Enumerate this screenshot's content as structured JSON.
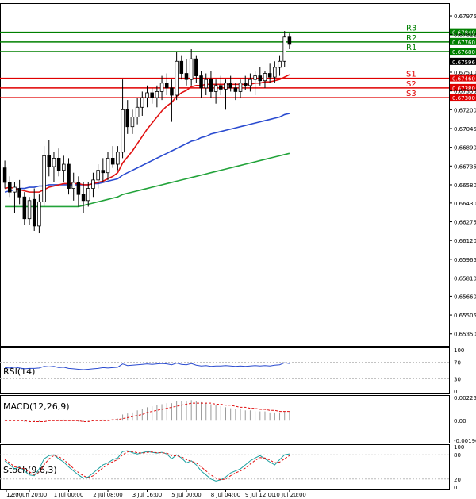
{
  "chart_data": {
    "type": "candlestick",
    "main": {
      "ylim": [
        0.6525,
        0.6808
      ],
      "price_ticks": [
        "0.67975",
        "0.67822",
        "0.67510",
        "0.67355",
        "0.67200",
        "0.67045",
        "0.66890",
        "0.66735",
        "0.66580",
        "0.66430",
        "0.66275",
        "0.66120",
        "0.65965",
        "0.65810",
        "0.65660",
        "0.65505",
        "0.65350"
      ],
      "current_price": 0.67596,
      "current_price_label": "0.67596",
      "levels": [
        {
          "name": "R3",
          "value": 0.6784,
          "label": "0.67840",
          "color": "#008000"
        },
        {
          "name": "R2",
          "value": 0.6776,
          "label": "0.67760",
          "color": "#008000"
        },
        {
          "name": "R1",
          "value": 0.6768,
          "label": "0.67680",
          "color": "#008000"
        },
        {
          "name": "S1",
          "value": 0.6746,
          "label": "0.67460",
          "color": "#e00000"
        },
        {
          "name": "S2",
          "value": 0.6738,
          "label": "0.67380",
          "color": "#e00000"
        },
        {
          "name": "S3",
          "value": 0.673,
          "label": "0.67300",
          "color": "#e00000"
        }
      ],
      "candles": [
        {
          "o": 0.6672,
          "h": 0.6678,
          "l": 0.6655,
          "c": 0.666
        },
        {
          "o": 0.666,
          "h": 0.6665,
          "l": 0.6648,
          "c": 0.6652
        },
        {
          "o": 0.6652,
          "h": 0.666,
          "l": 0.6635,
          "c": 0.6656
        },
        {
          "o": 0.6655,
          "h": 0.6662,
          "l": 0.6642,
          "c": 0.6648
        },
        {
          "o": 0.6648,
          "h": 0.6652,
          "l": 0.6625,
          "c": 0.663
        },
        {
          "o": 0.663,
          "h": 0.6648,
          "l": 0.6625,
          "c": 0.6645
        },
        {
          "o": 0.6646,
          "h": 0.6655,
          "l": 0.662,
          "c": 0.6624
        },
        {
          "o": 0.6624,
          "h": 0.665,
          "l": 0.6618,
          "c": 0.6644
        },
        {
          "o": 0.6644,
          "h": 0.669,
          "l": 0.664,
          "c": 0.6682
        },
        {
          "o": 0.6682,
          "h": 0.6695,
          "l": 0.6665,
          "c": 0.6673
        },
        {
          "o": 0.6673,
          "h": 0.6685,
          "l": 0.666,
          "c": 0.668
        },
        {
          "o": 0.668,
          "h": 0.6688,
          "l": 0.6665,
          "c": 0.667
        },
        {
          "o": 0.667,
          "h": 0.6682,
          "l": 0.666,
          "c": 0.6675
        },
        {
          "o": 0.6675,
          "h": 0.668,
          "l": 0.665,
          "c": 0.6655
        },
        {
          "o": 0.6655,
          "h": 0.6668,
          "l": 0.6645,
          "c": 0.666
        },
        {
          "o": 0.666,
          "h": 0.6665,
          "l": 0.664,
          "c": 0.665
        },
        {
          "o": 0.665,
          "h": 0.666,
          "l": 0.6635,
          "c": 0.6645
        },
        {
          "o": 0.6645,
          "h": 0.666,
          "l": 0.664,
          "c": 0.6655
        },
        {
          "o": 0.6655,
          "h": 0.6668,
          "l": 0.6648,
          "c": 0.6662
        },
        {
          "o": 0.6662,
          "h": 0.6675,
          "l": 0.6655,
          "c": 0.667
        },
        {
          "o": 0.667,
          "h": 0.668,
          "l": 0.666,
          "c": 0.6668
        },
        {
          "o": 0.6668,
          "h": 0.6685,
          "l": 0.6662,
          "c": 0.668
        },
        {
          "o": 0.668,
          "h": 0.669,
          "l": 0.6672,
          "c": 0.6675
        },
        {
          "o": 0.6675,
          "h": 0.669,
          "l": 0.667,
          "c": 0.6685
        },
        {
          "o": 0.6685,
          "h": 0.6745,
          "l": 0.668,
          "c": 0.672
        },
        {
          "o": 0.672,
          "h": 0.6728,
          "l": 0.67,
          "c": 0.6706
        },
        {
          "o": 0.6706,
          "h": 0.672,
          "l": 0.67,
          "c": 0.6714
        },
        {
          "o": 0.6714,
          "h": 0.673,
          "l": 0.6708,
          "c": 0.6722
        },
        {
          "o": 0.6722,
          "h": 0.6735,
          "l": 0.6715,
          "c": 0.673
        },
        {
          "o": 0.673,
          "h": 0.674,
          "l": 0.6722,
          "c": 0.6734
        },
        {
          "o": 0.6734,
          "h": 0.6738,
          "l": 0.6725,
          "c": 0.673
        },
        {
          "o": 0.673,
          "h": 0.674,
          "l": 0.6722,
          "c": 0.6735
        },
        {
          "o": 0.6735,
          "h": 0.6748,
          "l": 0.6728,
          "c": 0.6742
        },
        {
          "o": 0.6742,
          "h": 0.675,
          "l": 0.6732,
          "c": 0.6738
        },
        {
          "o": 0.6738,
          "h": 0.6745,
          "l": 0.671,
          "c": 0.6732
        },
        {
          "o": 0.6732,
          "h": 0.6768,
          "l": 0.6728,
          "c": 0.676
        },
        {
          "o": 0.676,
          "h": 0.6765,
          "l": 0.6745,
          "c": 0.675
        },
        {
          "o": 0.675,
          "h": 0.6762,
          "l": 0.674,
          "c": 0.6745
        },
        {
          "o": 0.6745,
          "h": 0.677,
          "l": 0.674,
          "c": 0.6762
        },
        {
          "o": 0.6762,
          "h": 0.6765,
          "l": 0.6742,
          "c": 0.6748
        },
        {
          "o": 0.6748,
          "h": 0.6752,
          "l": 0.673,
          "c": 0.6738
        },
        {
          "o": 0.6738,
          "h": 0.675,
          "l": 0.6732,
          "c": 0.6745
        },
        {
          "o": 0.6745,
          "h": 0.6752,
          "l": 0.673,
          "c": 0.6735
        },
        {
          "o": 0.6735,
          "h": 0.6745,
          "l": 0.6725,
          "c": 0.674
        },
        {
          "o": 0.674,
          "h": 0.6748,
          "l": 0.6732,
          "c": 0.6737
        },
        {
          "o": 0.6737,
          "h": 0.6745,
          "l": 0.672,
          "c": 0.6742
        },
        {
          "o": 0.6742,
          "h": 0.6748,
          "l": 0.6735,
          "c": 0.6738
        },
        {
          "o": 0.6738,
          "h": 0.6742,
          "l": 0.6728,
          "c": 0.6735
        },
        {
          "o": 0.6735,
          "h": 0.6745,
          "l": 0.673,
          "c": 0.6742
        },
        {
          "o": 0.6742,
          "h": 0.6748,
          "l": 0.6736,
          "c": 0.674
        },
        {
          "o": 0.674,
          "h": 0.675,
          "l": 0.6735,
          "c": 0.6745
        },
        {
          "o": 0.6745,
          "h": 0.6752,
          "l": 0.6732,
          "c": 0.6748
        },
        {
          "o": 0.6748,
          "h": 0.6755,
          "l": 0.674,
          "c": 0.6744
        },
        {
          "o": 0.6744,
          "h": 0.6752,
          "l": 0.6738,
          "c": 0.675
        },
        {
          "o": 0.675,
          "h": 0.6758,
          "l": 0.6742,
          "c": 0.6747
        },
        {
          "o": 0.6747,
          "h": 0.676,
          "l": 0.6742,
          "c": 0.6755
        },
        {
          "o": 0.6755,
          "h": 0.6765,
          "l": 0.6748,
          "c": 0.676
        },
        {
          "o": 0.676,
          "h": 0.6785,
          "l": 0.6755,
          "c": 0.678
        },
        {
          "o": 0.678,
          "h": 0.6783,
          "l": 0.677,
          "c": 0.6774
        }
      ],
      "ma_red": [
        0.6655,
        0.6656,
        0.6655,
        0.6654,
        0.6653,
        0.6652,
        0.6652,
        0.6652,
        0.6654,
        0.6656,
        0.6657,
        0.6658,
        0.6659,
        0.6659,
        0.6659,
        0.6659,
        0.6658,
        0.6658,
        0.6659,
        0.666,
        0.6661,
        0.6663,
        0.6665,
        0.6668,
        0.6676,
        0.6681,
        0.6686,
        0.6692,
        0.6698,
        0.6704,
        0.6709,
        0.6714,
        0.6719,
        0.6723,
        0.6726,
        0.6731,
        0.6734,
        0.6736,
        0.6739,
        0.674,
        0.674,
        0.6741,
        0.6741,
        0.6741,
        0.6741,
        0.6741,
        0.6741,
        0.6741,
        0.6741,
        0.6741,
        0.6741,
        0.6742,
        0.6742,
        0.6743,
        0.6743,
        0.6744,
        0.6745,
        0.6747,
        0.6749
      ],
      "ma_blue": [
        0.6652,
        0.6653,
        0.6654,
        0.6655,
        0.6655,
        0.6656,
        0.6656,
        0.6657,
        0.6657,
        0.6658,
        0.6658,
        0.6658,
        0.6658,
        0.6658,
        0.6658,
        0.6658,
        0.6658,
        0.6658,
        0.6659,
        0.6659,
        0.666,
        0.6661,
        0.6662,
        0.6663,
        0.6666,
        0.6668,
        0.667,
        0.6672,
        0.6674,
        0.6676,
        0.6678,
        0.668,
        0.6682,
        0.6684,
        0.6686,
        0.6688,
        0.669,
        0.6692,
        0.6694,
        0.6695,
        0.6697,
        0.6698,
        0.67,
        0.6701,
        0.6702,
        0.6703,
        0.6704,
        0.6705,
        0.6706,
        0.6707,
        0.6708,
        0.6709,
        0.671,
        0.6711,
        0.6712,
        0.6713,
        0.6714,
        0.6716,
        0.6717
      ],
      "ma_green": [
        0.664,
        0.664,
        0.664,
        0.664,
        0.664,
        0.664,
        0.664,
        0.664,
        0.664,
        0.664,
        0.664,
        0.664,
        0.664,
        0.664,
        0.664,
        0.664,
        0.6641,
        0.6642,
        0.6643,
        0.6644,
        0.6645,
        0.6646,
        0.6647,
        0.6648,
        0.665,
        0.6651,
        0.6652,
        0.6653,
        0.6654,
        0.6655,
        0.6656,
        0.6657,
        0.6658,
        0.6659,
        0.666,
        0.6661,
        0.6662,
        0.6663,
        0.6664,
        0.6665,
        0.6666,
        0.6667,
        0.6668,
        0.6669,
        0.667,
        0.6671,
        0.6672,
        0.6673,
        0.6674,
        0.6675,
        0.6676,
        0.6677,
        0.6678,
        0.6679,
        0.668,
        0.6681,
        0.6682,
        0.6683,
        0.6684
      ]
    },
    "rsi": {
      "label": "RSI(14)",
      "ticks": [
        "100",
        "70",
        "30",
        "0"
      ],
      "tick_values": [
        100,
        70,
        30,
        0
      ],
      "values": [
        57,
        56,
        58,
        56,
        54,
        55,
        55,
        56,
        60,
        59,
        60,
        57,
        58,
        55,
        54,
        53,
        52,
        53,
        54,
        55,
        57,
        56,
        57,
        58,
        66,
        62,
        63,
        64,
        65,
        66,
        65,
        66,
        67,
        66,
        64,
        68,
        65,
        64,
        67,
        63,
        61,
        62,
        60,
        61,
        61,
        62,
        61,
        60,
        61,
        60,
        61,
        62,
        61,
        62,
        61,
        63,
        64,
        69,
        67
      ]
    },
    "macd": {
      "label": "MACD(12,26,9)",
      "ticks": [
        "0.002253",
        "0.00",
        "-0.001907"
      ],
      "tick_values": [
        0.002253,
        0.0,
        -0.001907
      ],
      "hist": [
        0.0001,
        0.0001,
        0.0,
        0.0,
        -0.0001,
        -0.0001,
        -0.0001,
        -0.0001,
        0.0,
        0.0,
        0.0,
        0.0001,
        0.0001,
        0.0,
        0.0,
        -0.0001,
        -0.0001,
        -0.0001,
        0.0,
        0.0,
        0.0001,
        0.0001,
        0.0001,
        0.0002,
        0.0006,
        0.0007,
        0.0008,
        0.001,
        0.0011,
        0.0013,
        0.0014,
        0.0015,
        0.0016,
        0.0017,
        0.0017,
        0.0019,
        0.0019,
        0.0019,
        0.002,
        0.0019,
        0.0018,
        0.0017,
        0.0016,
        0.0015,
        0.0014,
        0.0013,
        0.0012,
        0.0011,
        0.0011,
        0.001,
        0.001,
        0.0009,
        0.0009,
        0.0009,
        0.0008,
        0.0008,
        0.0008,
        0.0009,
        0.0009
      ],
      "signal": [
        0.0,
        0.0,
        0.0,
        0.0,
        0.0,
        -0.0001,
        -0.0001,
        -0.0001,
        -0.0001,
        0.0,
        0.0,
        0.0,
        0.0,
        0.0,
        0.0,
        0.0,
        -0.0001,
        -0.0001,
        0.0,
        0.0,
        0.0,
        0.0,
        0.0001,
        0.0001,
        0.0002,
        0.0003,
        0.0004,
        0.0005,
        0.0006,
        0.0008,
        0.0009,
        0.001,
        0.0011,
        0.0012,
        0.0013,
        0.0014,
        0.0015,
        0.0016,
        0.0017,
        0.0017,
        0.0017,
        0.0017,
        0.0017,
        0.0016,
        0.0016,
        0.0015,
        0.0015,
        0.0014,
        0.0013,
        0.0013,
        0.0012,
        0.0012,
        0.0011,
        0.0011,
        0.001,
        0.001,
        0.0009,
        0.0009,
        0.0009
      ]
    },
    "stoch": {
      "label": "Stoch(9,6,3)",
      "ticks": [
        "100",
        "80",
        "20",
        "0"
      ],
      "tick_values": [
        100,
        80,
        20,
        0
      ],
      "k": [
        65,
        55,
        45,
        50,
        40,
        30,
        28,
        45,
        70,
        78,
        80,
        70,
        62,
        50,
        40,
        30,
        22,
        25,
        35,
        45,
        55,
        60,
        68,
        72,
        88,
        90,
        85,
        82,
        85,
        88,
        86,
        84,
        86,
        82,
        70,
        80,
        72,
        60,
        65,
        55,
        40,
        30,
        20,
        15,
        18,
        25,
        35,
        40,
        45,
        55,
        65,
        72,
        78,
        70,
        62,
        55,
        68,
        80,
        82
      ],
      "d": [
        68,
        60,
        50,
        48,
        45,
        38,
        30,
        35,
        55,
        70,
        78,
        75,
        68,
        57,
        46,
        36,
        28,
        23,
        28,
        38,
        48,
        56,
        63,
        68,
        80,
        87,
        88,
        85,
        84,
        86,
        87,
        85,
        85,
        84,
        78,
        77,
        75,
        68,
        64,
        60,
        50,
        40,
        30,
        22,
        18,
        20,
        28,
        35,
        40,
        47,
        57,
        66,
        73,
        72,
        67,
        60,
        62,
        70,
        78
      ]
    },
    "x_tick_labels": [
      "12:00",
      "27 Jun 20:00",
      "1 Jul 00:00",
      "2 Jul 08:00",
      "3 Jul 16:00",
      "5 Jul 00:00",
      "8 Jul 04:00",
      "9 Jul 12:00",
      "10 Jul 20:00"
    ],
    "x_tick_index": [
      0,
      5,
      13,
      21,
      29,
      37,
      45,
      52,
      58
    ]
  }
}
